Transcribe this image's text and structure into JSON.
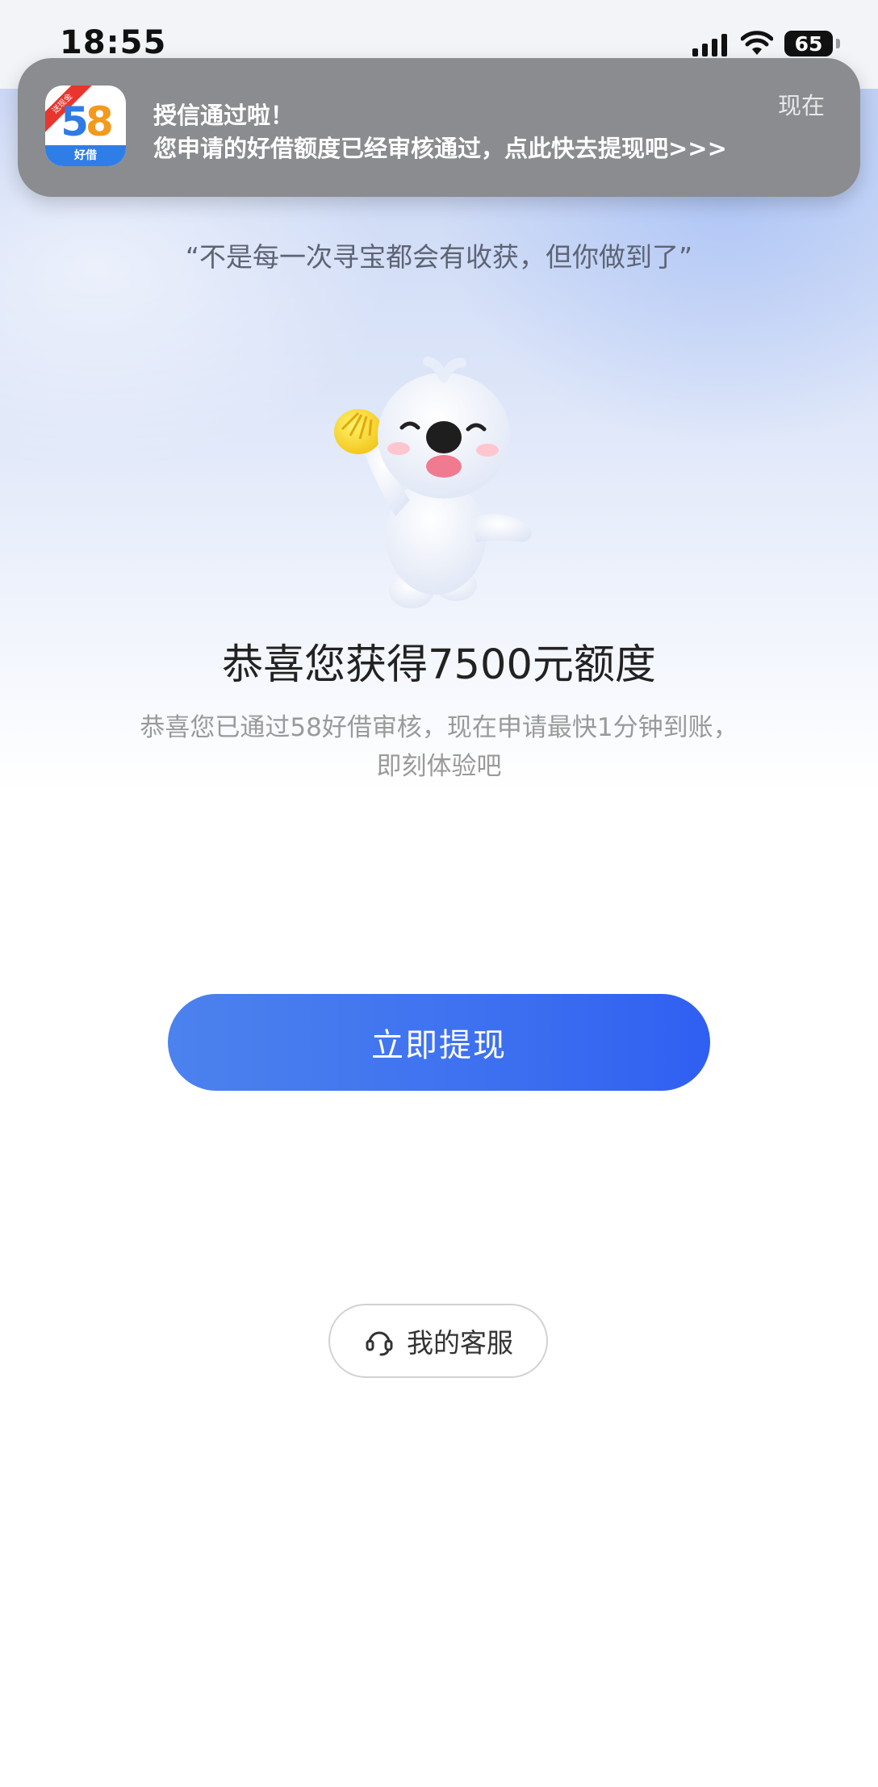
{
  "status_bar": {
    "time": "18:55",
    "battery": "65"
  },
  "notification": {
    "app_icon": {
      "ribbon": "送现金",
      "number_a": "5",
      "number_b": "8",
      "label": "好借"
    },
    "title": "授信通过啦！",
    "body": "您申请的好借额度已经审核通过，点此快去提现吧>>>",
    "time": "现在"
  },
  "quote": "“不是每一次寻宝都会有收获，但你做到了”",
  "headline": "恭喜您获得7500元额度",
  "subtext_line1": "恭喜您已通过58好借审核，现在申请最快1分钟到账，",
  "subtext_line2": "即刻体验吧",
  "cta_label": "立即提现",
  "service_label": "我的客服",
  "colors": {
    "cta_start": "#4c82ee",
    "cta_end": "#2f5ff2",
    "notification_bg": "#8b8c8f"
  }
}
